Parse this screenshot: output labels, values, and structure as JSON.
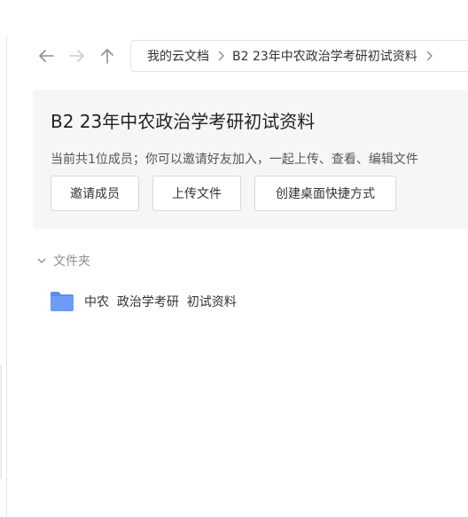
{
  "nav": {
    "back_icon": "arrow-left-icon",
    "forward_icon": "arrow-right-icon",
    "up_icon": "arrow-up-icon"
  },
  "breadcrumb": {
    "items": [
      "我的云文档",
      "B2  23年中农政治学考研初试资料"
    ]
  },
  "header": {
    "title": "B2  23年中农政治学考研初试资料",
    "description": "当前共1位成员；你可以邀请好友加入，一起上传、查看、编辑文件",
    "buttons": {
      "invite": "邀请成员",
      "upload": "上传文件",
      "shortcut": "创建桌面快捷方式"
    }
  },
  "section": {
    "label": "文件夹"
  },
  "files": [
    {
      "name": "中农  政治学考研  初试资料",
      "icon": "folder-icon"
    }
  ],
  "colors": {
    "panel_bg": "#f5f6f7",
    "folder_blue": "#6d9cf6"
  }
}
